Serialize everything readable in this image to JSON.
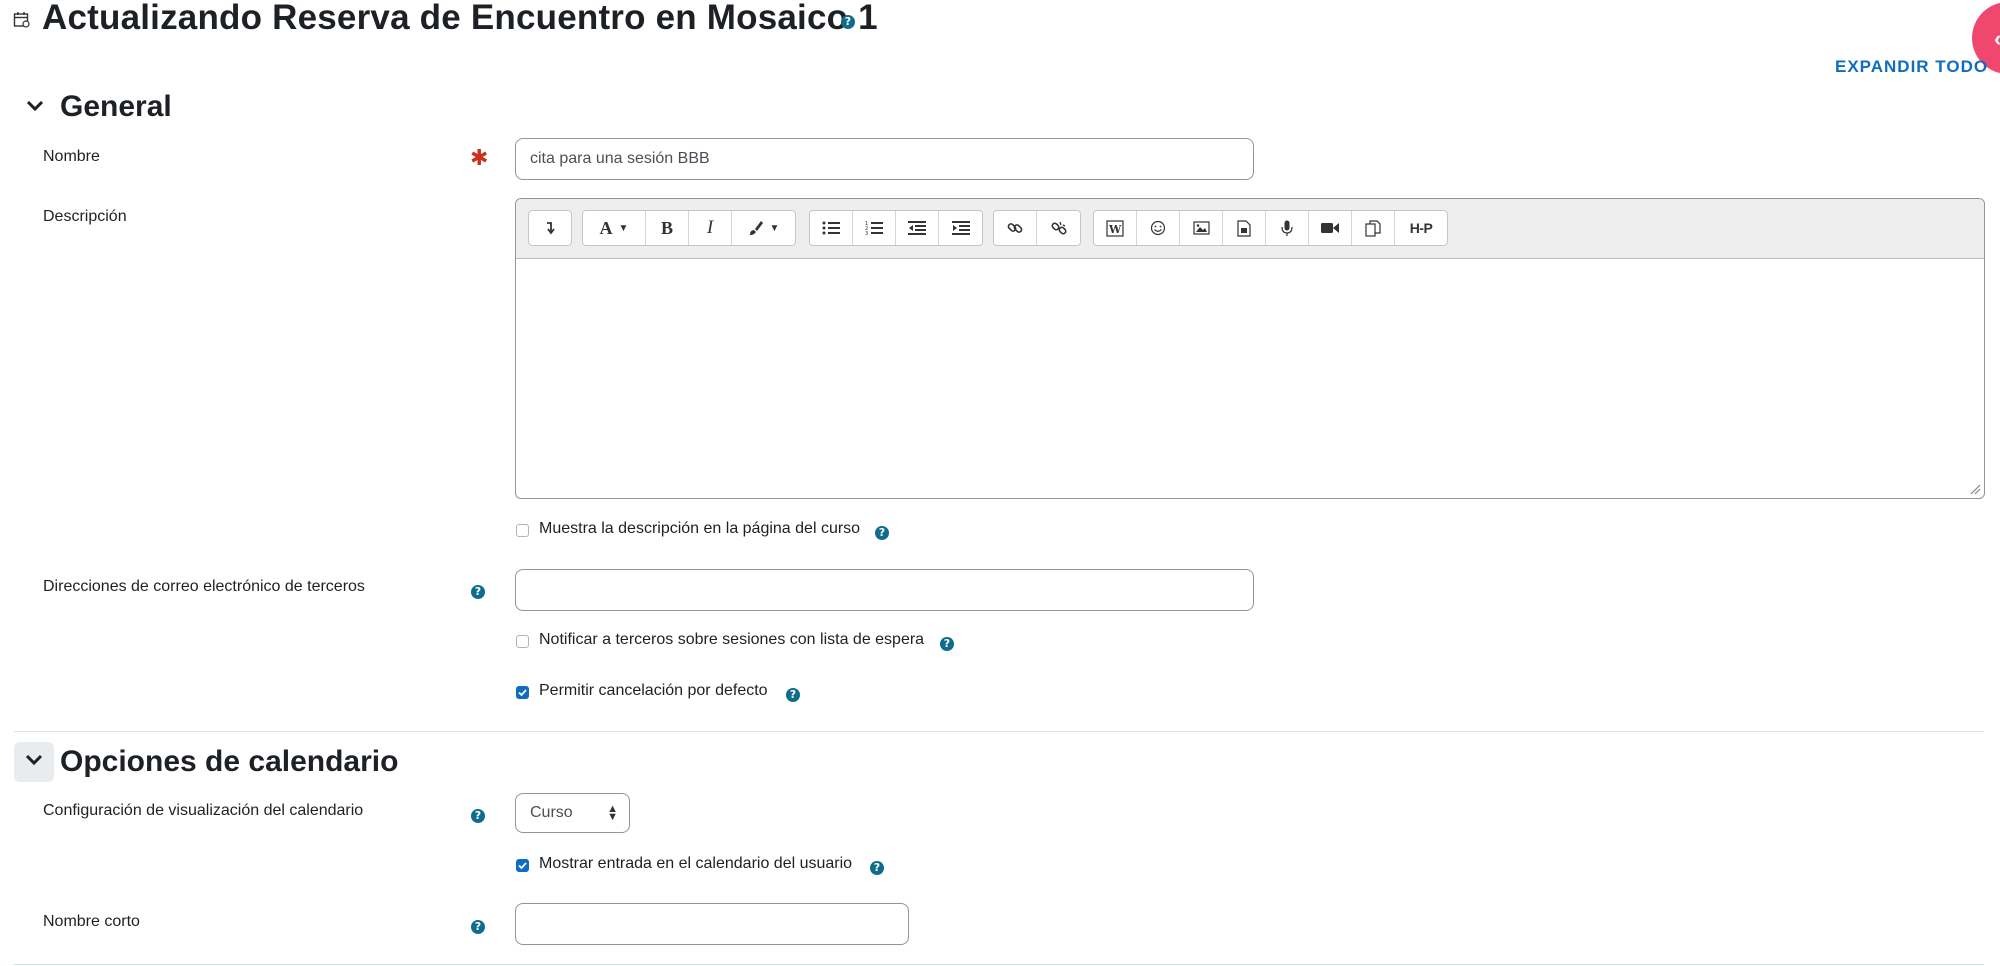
{
  "page": {
    "title": "Actualizando Reserva de Encuentro en Mosaico 1",
    "expand_all": "EXPANDIR TODO"
  },
  "sections": {
    "general": {
      "title": "General",
      "name_label": "Nombre",
      "name_value": "cita para una sesión BBB",
      "description_label": "Descripción",
      "show_description_label": "Muestra la descripción en la página del curso",
      "show_description_checked": false,
      "third_party_label": "Direcciones de correo electrónico de terceros",
      "third_party_value": "",
      "notify_third_party_label": "Notificar a terceros sobre sesiones con lista de espera",
      "notify_third_party_checked": false,
      "allow_cancel_label": "Permitir cancelación por defecto",
      "allow_cancel_checked": true
    },
    "calendar": {
      "title": "Opciones de calendario",
      "display_label": "Configuración de visualización del calendario",
      "display_value": "Curso",
      "show_user_cal_label": "Mostrar entrada en el calendario del usuario",
      "show_user_cal_checked": true,
      "short_name_label": "Nombre corto",
      "short_name_value": ""
    }
  },
  "editor_toolbar": {
    "groups": [
      [
        "collapse-icon"
      ],
      [
        "font-style-icon",
        "bold-icon",
        "italic-icon",
        "text-color-icon"
      ],
      [
        "unordered-list-icon",
        "ordered-list-icon",
        "outdent-icon",
        "indent-icon"
      ],
      [
        "link-icon",
        "unlink-icon"
      ],
      [
        "word-import-icon",
        "emoji-icon",
        "image-icon",
        "media-icon",
        "record-audio-icon",
        "record-video-icon",
        "manage-files-icon",
        "h5p-icon"
      ]
    ],
    "labels": {
      "bold": "B",
      "italic": "I",
      "font": "A",
      "h5p": "H-P"
    }
  },
  "colors": {
    "accent": "#0f6cbf",
    "help_icon": "#0f6c8c",
    "required": "#ca3120",
    "fab": "#f0476f"
  }
}
